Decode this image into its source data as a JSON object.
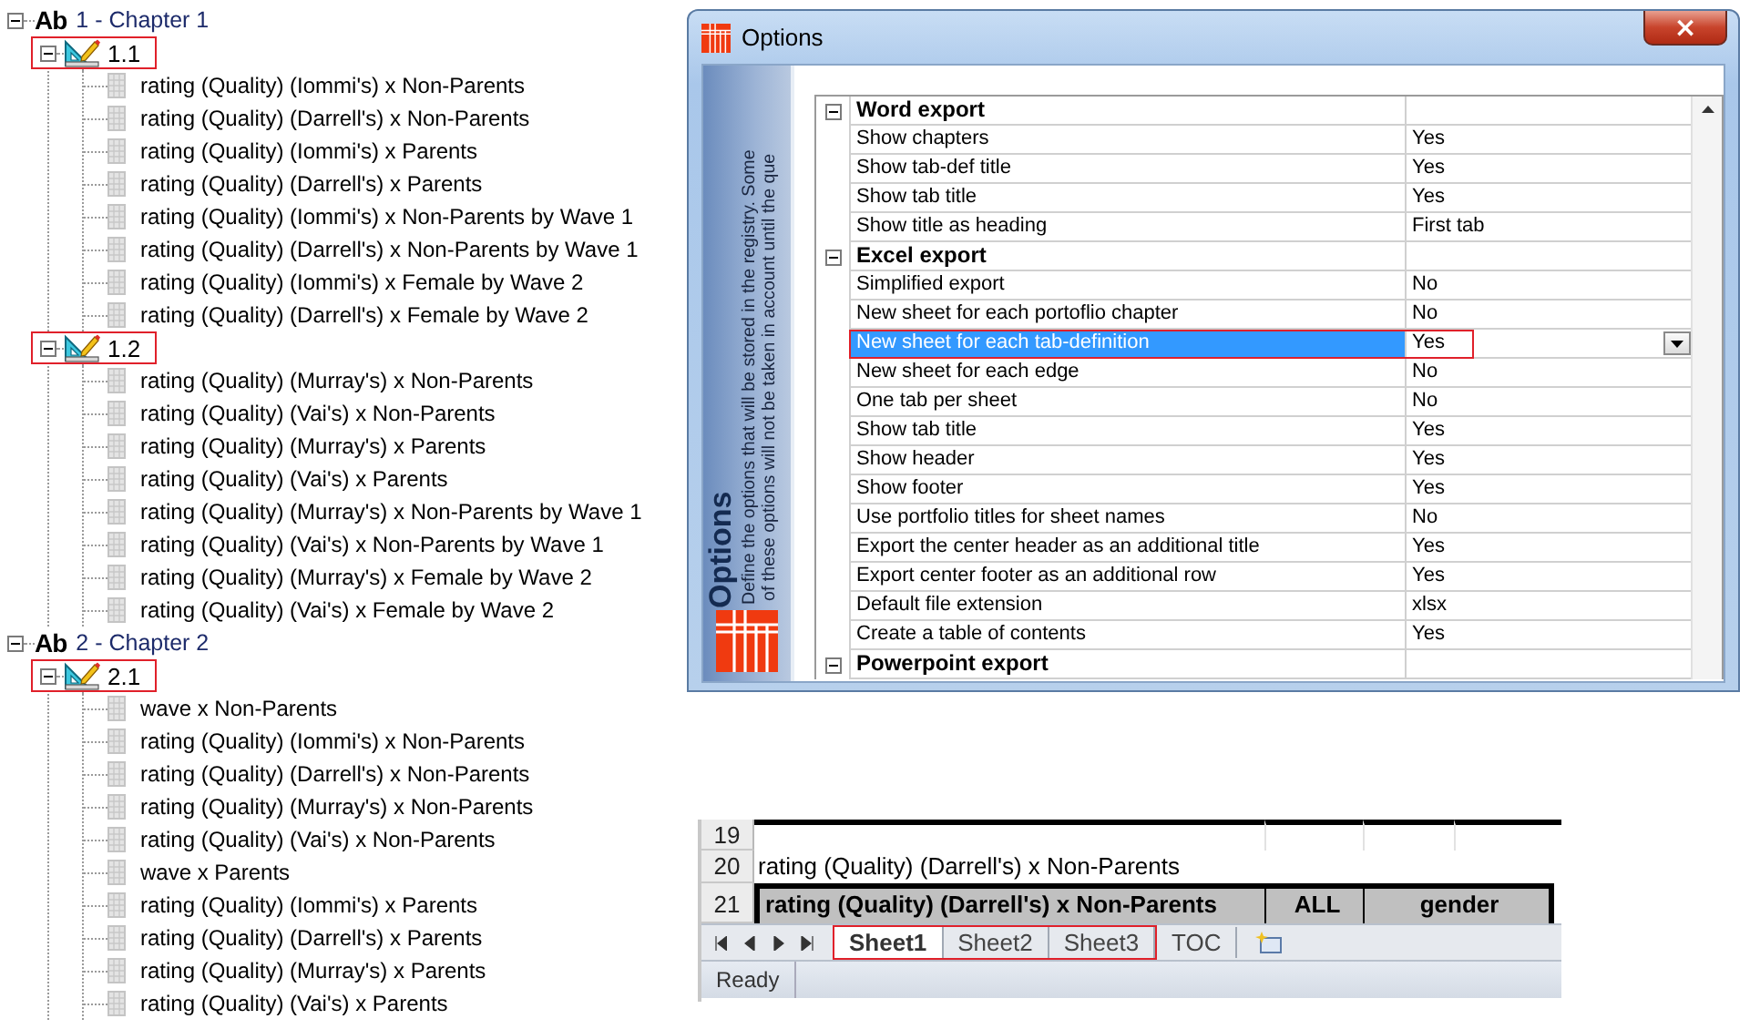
{
  "tree": {
    "chapters": [
      {
        "badge": "Ab",
        "label": "1 - Chapter 1",
        "expanded": true,
        "children": [
          {
            "label": "1.1",
            "expanded": true,
            "highlighted": true,
            "children": [
              {
                "label": "rating (Quality) (Iommi's) x Non-Parents"
              },
              {
                "label": "rating (Quality) (Darrell's) x Non-Parents"
              },
              {
                "label": "rating (Quality) (Iommi's) x Parents"
              },
              {
                "label": "rating (Quality) (Darrell's) x Parents"
              },
              {
                "label": "rating (Quality) (Iommi's) x Non-Parents by Wave 1"
              },
              {
                "label": "rating (Quality) (Darrell's) x Non-Parents by Wave 1"
              },
              {
                "label": "rating (Quality) (Iommi's) x Female by Wave 2"
              },
              {
                "label": "rating (Quality) (Darrell's) x Female by Wave 2"
              }
            ]
          },
          {
            "label": "1.2",
            "expanded": true,
            "highlighted": true,
            "children": [
              {
                "label": "rating (Quality) (Murray's) x Non-Parents"
              },
              {
                "label": "rating (Quality) (Vai's) x Non-Parents"
              },
              {
                "label": "rating (Quality) (Murray's) x Parents"
              },
              {
                "label": "rating (Quality) (Vai's) x Parents"
              },
              {
                "label": "rating (Quality) (Murray's) x Non-Parents by Wave 1"
              },
              {
                "label": "rating (Quality) (Vai's) x Non-Parents by Wave 1"
              },
              {
                "label": "rating (Quality) (Murray's) x Female by Wave 2"
              },
              {
                "label": "rating (Quality) (Vai's) x Female by Wave 2"
              }
            ]
          }
        ]
      },
      {
        "badge": "Ab",
        "label": "2 - Chapter 2",
        "expanded": true,
        "children": [
          {
            "label": "2.1",
            "expanded": true,
            "highlighted": true,
            "children": [
              {
                "label": "wave x Non-Parents"
              },
              {
                "label": "rating (Quality) (Iommi's) x Non-Parents"
              },
              {
                "label": "rating (Quality) (Darrell's) x Non-Parents"
              },
              {
                "label": "rating (Quality) (Murray's) x Non-Parents"
              },
              {
                "label": "rating (Quality) (Vai's) x Non-Parents"
              },
              {
                "label": "wave x Parents"
              },
              {
                "label": "rating (Quality) (Iommi's) x Parents"
              },
              {
                "label": "rating (Quality) (Darrell's) x Parents"
              },
              {
                "label": "rating (Quality) (Murray's) x Parents"
              },
              {
                "label": "rating (Quality) (Vai's) x Parents"
              }
            ]
          }
        ]
      }
    ]
  },
  "options_dialog": {
    "title": "Options",
    "close": "×",
    "sidebar": {
      "heading": "Options",
      "description_lines": [
        "Define the options that will be stored in the registry. Some",
        "of these options will not be taken in account until the que"
      ]
    },
    "groups": [
      {
        "title": "Word export",
        "expanded": true,
        "options": [
          {
            "name": "Show chapters",
            "value": "Yes",
            "selected": false,
            "highlighted": false
          },
          {
            "name": "Show tab-def title",
            "value": "Yes",
            "selected": false,
            "highlighted": false
          },
          {
            "name": "Show tab title",
            "value": "Yes",
            "selected": false,
            "highlighted": false
          },
          {
            "name": "Show title as heading",
            "value": "First tab",
            "selected": false,
            "highlighted": false
          }
        ]
      },
      {
        "title": "Excel export",
        "expanded": true,
        "options": [
          {
            "name": "Simplified export",
            "value": "No",
            "selected": false,
            "highlighted": false
          },
          {
            "name": "New sheet for each portoflio chapter",
            "value": "No",
            "selected": false,
            "highlighted": false
          },
          {
            "name": "New sheet for each tab-definition",
            "value": "Yes",
            "selected": true,
            "highlighted": true
          },
          {
            "name": "New sheet for each edge",
            "value": "No",
            "selected": false,
            "highlighted": false
          },
          {
            "name": "One tab per sheet",
            "value": "No",
            "selected": false,
            "highlighted": false
          },
          {
            "name": "Show tab title",
            "value": "Yes",
            "selected": false,
            "highlighted": false
          },
          {
            "name": "Show header",
            "value": "Yes",
            "selected": false,
            "highlighted": false
          },
          {
            "name": "Show footer",
            "value": "Yes",
            "selected": false,
            "highlighted": false
          },
          {
            "name": "Use portfolio titles for sheet names",
            "value": "No",
            "selected": false,
            "highlighted": false
          },
          {
            "name": "Export the center header as an additional title",
            "value": "Yes",
            "selected": false,
            "highlighted": false
          },
          {
            "name": "Export center footer as an additional row",
            "value": "Yes",
            "selected": false,
            "highlighted": false
          },
          {
            "name": "Default file extension",
            "value": "xlsx",
            "selected": false,
            "highlighted": false
          },
          {
            "name": "Create a table of contents",
            "value": "Yes",
            "selected": false,
            "highlighted": false
          }
        ]
      },
      {
        "title": "Powerpoint export",
        "expanded": true
      }
    ]
  },
  "excel": {
    "rows": [
      {
        "number": "19",
        "kind": "blank",
        "cells": []
      },
      {
        "number": "20",
        "kind": "text",
        "cells": [
          "rating (Quality) (Darrell's) x Non-Parents"
        ]
      },
      {
        "number": "21",
        "kind": "header",
        "cells": [
          "rating (Quality) (Darrell's) x Non-Parents",
          "ALL",
          "gender"
        ]
      }
    ],
    "sheet_tabs": [
      {
        "label": "Sheet1",
        "selected": true,
        "highlighted": true
      },
      {
        "label": "Sheet2",
        "selected": false,
        "highlighted": true
      },
      {
        "label": "Sheet3",
        "selected": false,
        "highlighted": true
      },
      {
        "label": "TOC",
        "selected": false,
        "highlighted": false
      }
    ],
    "status": "Ready"
  }
}
